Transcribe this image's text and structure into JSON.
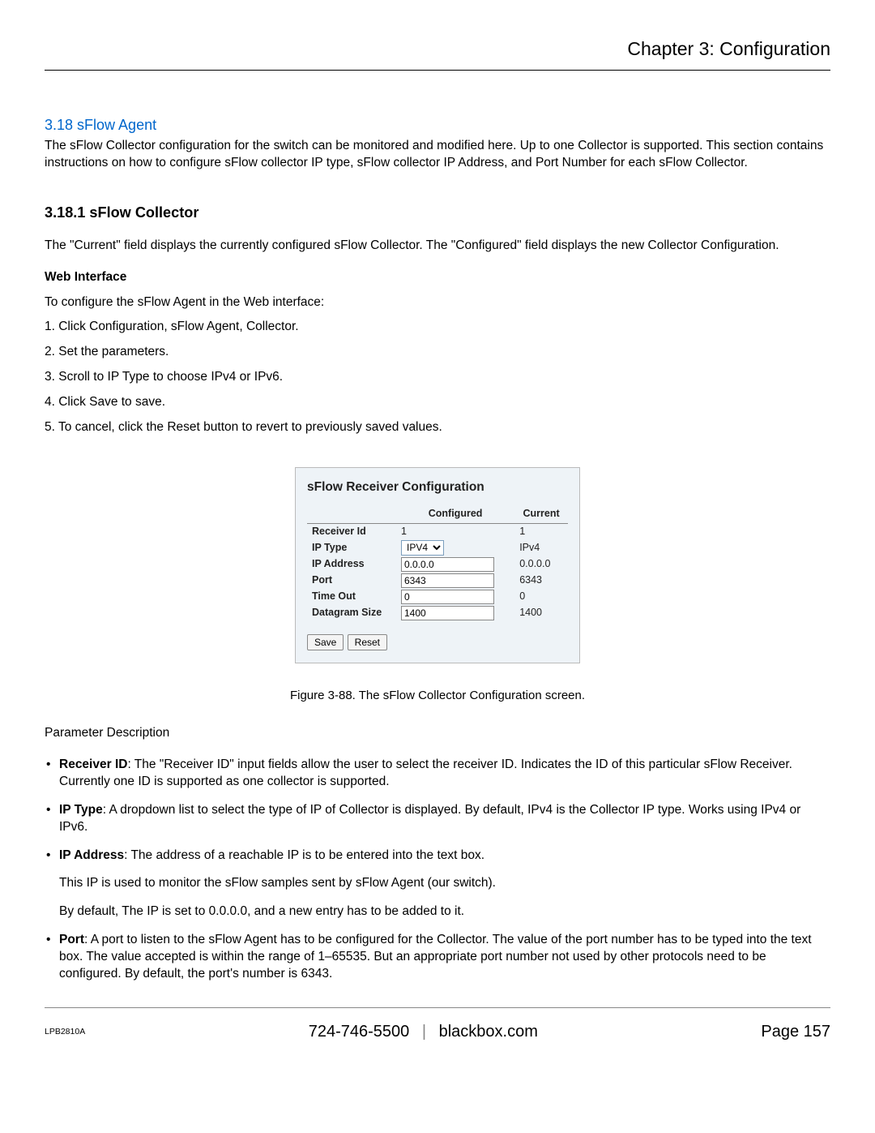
{
  "chapter_title": "Chapter 3: Configuration",
  "section": {
    "heading": "3.18 sFlow Agent",
    "intro": "The sFlow Collector configuration for the switch can be monitored and modified here. Up to one Collector is supported. This section contains instructions on how to configure sFlow collector IP type, sFlow collector IP Address, and Port Number for each sFlow Collector."
  },
  "subsection": {
    "heading": "3.18.1 sFlow Collector",
    "paragraph": "The \"Current\" field displays the currently configured sFlow Collector. The \"Configured\" field displays the new Collector Configuration."
  },
  "webinterface": {
    "heading": "Web Interface",
    "intro": "To configure the sFlow Agent in the Web interface:",
    "steps": [
      "1. Click Configuration, sFlow Agent, Collector.",
      "2. Set the parameters.",
      "3. Scroll to IP Type to choose IPv4 or IPv6.",
      "4. Click Save to save.",
      "5. To cancel, click the Reset button to revert to previously saved values."
    ]
  },
  "screenshot": {
    "title": "sFlow Receiver Configuration",
    "columns": {
      "configured": "Configured",
      "current": "Current"
    },
    "rows": {
      "receiver_id": {
        "label": "Receiver Id",
        "configured": "1",
        "current": "1"
      },
      "ip_type": {
        "label": "IP Type",
        "configured": "IPV4",
        "current": "IPv4"
      },
      "ip_address": {
        "label": "IP Address",
        "configured": "0.0.0.0",
        "current": "0.0.0.0"
      },
      "port": {
        "label": "Port",
        "configured": "6343",
        "current": "6343"
      },
      "time_out": {
        "label": "Time Out",
        "configured": "0",
        "current": "0"
      },
      "datagram": {
        "label": "Datagram Size",
        "configured": "1400",
        "current": "1400"
      }
    },
    "buttons": {
      "save": "Save",
      "reset": "Reset"
    }
  },
  "figure_caption": "Figure 3-88. The sFlow Collector Configuration screen.",
  "param_desc_heading": "Parameter Description",
  "params": {
    "receiver_id": {
      "label": "Receiver ID",
      "text": ": The \"Receiver ID\" input fields allow the user to select the receiver ID. Indicates the ID of this particular sFlow Receiver. Currently one ID is supported as one collector is supported."
    },
    "ip_type": {
      "label": "IP Type",
      "text": ": A dropdown list to select the type of IP of Collector is displayed. By default, IPv4 is the Collector IP type. Works using IPv4 or IPv6."
    },
    "ip_address": {
      "label": "IP Address",
      "text": ": The address of a reachable IP is to be entered into the text box.",
      "sub1": "This IP is used to monitor the sFlow samples sent by sFlow Agent (our switch).",
      "sub2": "By default, The IP is set to 0.0.0.0, and a new entry has to be added to it."
    },
    "port": {
      "label": "Port",
      "text": ": A port to listen to the sFlow Agent has to be configured for the Collector. The value of the port number has to be typed into the text box. The value accepted is within the range of 1–65535. But an appropriate port number not used by other protocols need to be configured. By default, the port's number is 6343."
    }
  },
  "footer": {
    "product": "LPB2810A",
    "phone": "724-746-5500",
    "site": "blackbox.com",
    "page_label": "Page 157"
  }
}
